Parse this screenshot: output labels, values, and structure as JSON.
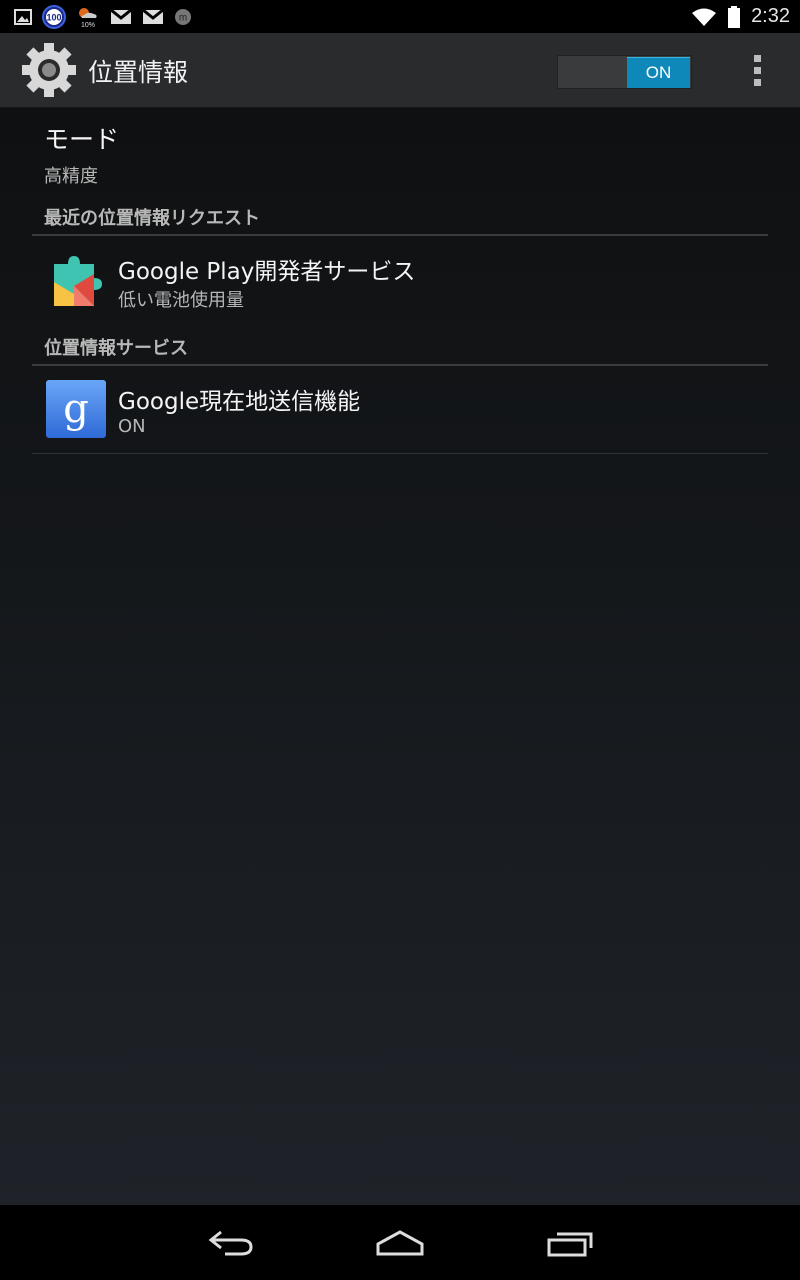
{
  "status_bar": {
    "time": "2:32",
    "badge_100": "100",
    "weather_temp": "10%",
    "icons": [
      "image-icon",
      "battery-100-icon",
      "weather-icon",
      "gmail-icon",
      "gmail-icon",
      "messenger-icon",
      "wifi-icon",
      "battery-icon"
    ]
  },
  "action_bar": {
    "title": "位置情報",
    "toggle_label": "ON",
    "icon": "settings-gear-icon",
    "menu_icon": "overflow-menu-icon"
  },
  "mode": {
    "title": "モード",
    "summary": "高精度"
  },
  "recent_requests": {
    "header": "最近の位置情報リクエスト",
    "items": [
      {
        "title": "Google Play開発者サービス",
        "summary": "低い電池使用量",
        "icon": "play-services-icon"
      }
    ]
  },
  "location_services": {
    "header": "位置情報サービス",
    "items": [
      {
        "title": "Google現在地送信機能",
        "summary": "ON",
        "icon": "google-search-icon"
      }
    ]
  },
  "nav_bar": {
    "buttons": [
      "back-icon",
      "home-icon",
      "recents-icon"
    ]
  },
  "colors": {
    "accent": "#0e88b8",
    "action_bar_bg": "#2a2b2d"
  }
}
